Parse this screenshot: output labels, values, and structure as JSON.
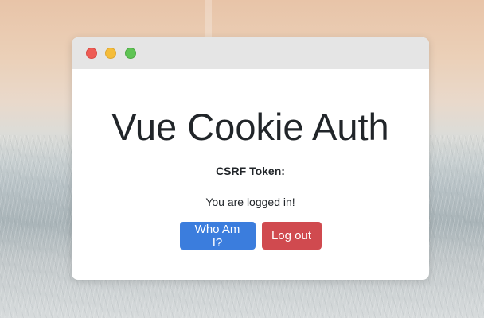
{
  "window": {
    "title": "Vue Cookie Auth",
    "csrf_label": "CSRF Token:",
    "status_text": "You are logged in!",
    "buttons": {
      "who_am_i": "Who Am I?",
      "log_out": "Log out"
    },
    "titlebar_controls": [
      "close-icon",
      "minimize-icon",
      "maximize-icon"
    ]
  },
  "colors": {
    "primary": "#3b7ddd",
    "danger": "#d04a4f",
    "close": "#ee5c55",
    "minimize": "#f5bd3a",
    "maximize": "#5fc454"
  }
}
